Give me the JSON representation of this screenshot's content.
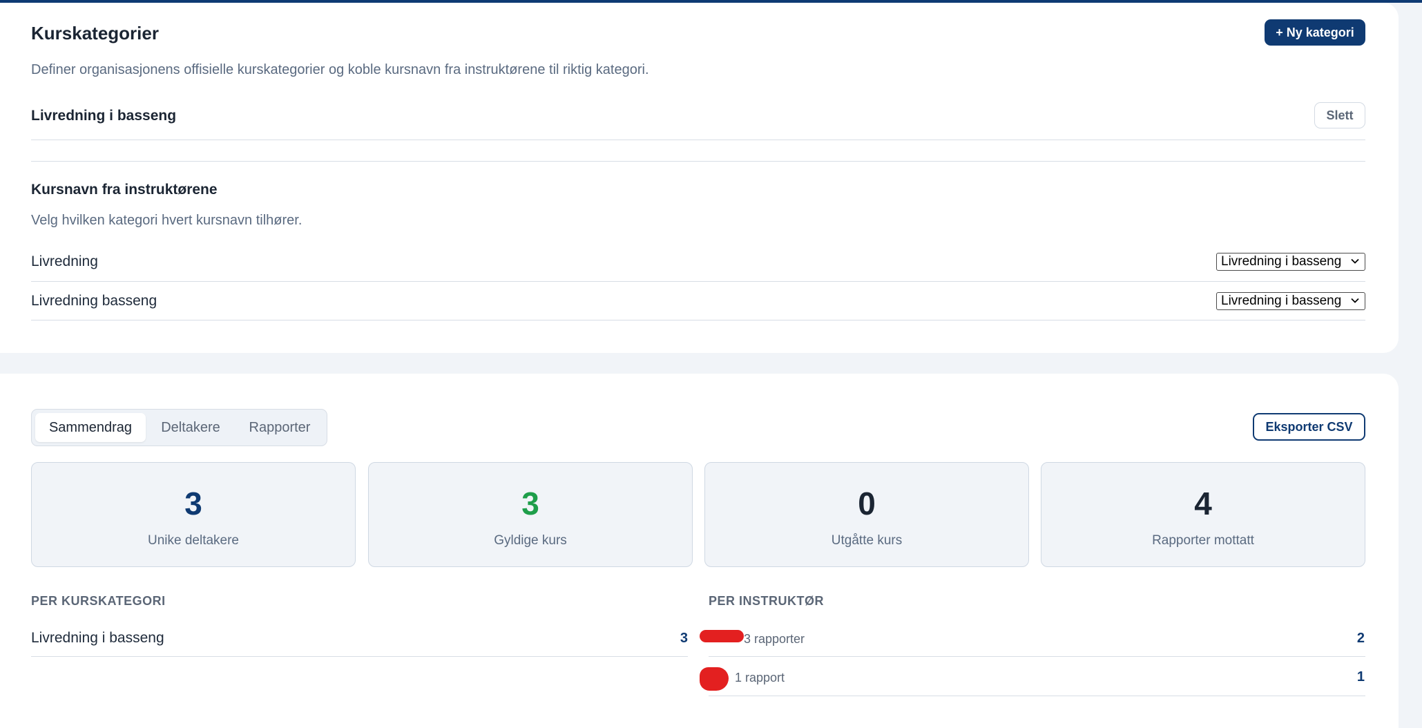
{
  "categories": {
    "title": "Kurskategorier",
    "new_button": "+ Ny kategori",
    "description": "Definer organisasjonens offisielle kurskategorier og koble kursnavn fra instruktørene til riktig kategori.",
    "items": [
      {
        "name": "Livredning i basseng",
        "delete_label": "Slett"
      }
    ],
    "mapping": {
      "title": "Kursnavn fra instruktørene",
      "description": "Velg hvilken kategori hvert kursnavn tilhører.",
      "rows": [
        {
          "course_name": "Livredning",
          "selected": "Livredning i basseng"
        },
        {
          "course_name": "Livredning basseng",
          "selected": "Livredning i basseng"
        }
      ]
    }
  },
  "summary": {
    "tabs": [
      {
        "label": "Sammendrag",
        "active": true
      },
      {
        "label": "Deltakere",
        "active": false
      },
      {
        "label": "Rapporter",
        "active": false
      }
    ],
    "export_button": "Eksporter CSV",
    "stats": [
      {
        "value": "3",
        "label": "Unike deltakere",
        "color": "#0f3a72"
      },
      {
        "value": "3",
        "label": "Gyldige kurs",
        "color": "#1e9e4a"
      },
      {
        "value": "0",
        "label": "Utgåtte kurs",
        "color": "#1b2533"
      },
      {
        "value": "4",
        "label": "Rapporter mottatt",
        "color": "#1b2533"
      }
    ],
    "per_category": {
      "heading": "PER KURSKATEGORI",
      "rows": [
        {
          "label": "Livredning i basseng",
          "value": "3"
        }
      ]
    },
    "per_instructor": {
      "heading": "PER INSTRUKTØR",
      "rows": [
        {
          "label": "3 rapporter",
          "value": "2"
        },
        {
          "label": "1 rapport",
          "value": "1"
        }
      ]
    }
  },
  "colors": {
    "brand": "#0f3a72",
    "valid_green": "#1e9e4a",
    "redaction": "#e32020"
  }
}
